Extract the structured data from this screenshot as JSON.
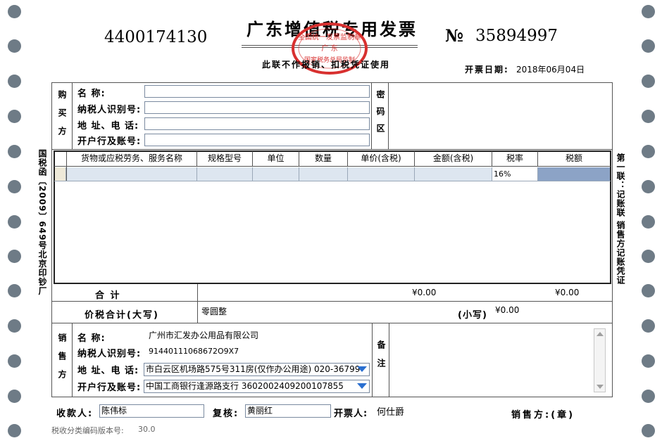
{
  "header": {
    "invoice_code": "4400174130",
    "title": "广东增值税专用发票",
    "number_symbol": "№",
    "invoice_number": "35894997",
    "subtitle": "此联不作报销、扣税凭证使用",
    "date_label": "开票日期:",
    "date_value": "2018年06月04日",
    "stamp_text": "全国统一发票监制章",
    "stamp_center": "国家税务总局监制",
    "stamp_region": "广 东"
  },
  "left_margin_text": "国税函〔2009〕649号北京印钞厂",
  "right_margin_text": "第一联：记账联 销售方记账凭证",
  "buyer": {
    "section": "购买方",
    "name_label": "名        称:",
    "taxid_label": "纳税人识别号:",
    "address_label": "地 址、电 话:",
    "bank_label": "开户行及账号:",
    "name_value": "",
    "taxid_value": "",
    "address_value": "",
    "bank_value": ""
  },
  "cipher_label": "密码区",
  "items_table": {
    "headers": [
      "货物或应税劳务、服务名称",
      "规格型号",
      "单位",
      "数量",
      "单价(含税)",
      "金额(含税)",
      "税率",
      "税额"
    ],
    "row": {
      "tax_rate": "16%"
    }
  },
  "totals": {
    "label": "合        计",
    "amount": "¥0.00",
    "tax": "¥0.00",
    "grand_label": "价税合计(大写)",
    "grand_upper": "零圆整",
    "small_label": "(小写)",
    "grand_small": "¥0.00"
  },
  "seller": {
    "section": "销售方",
    "name_label": "名        称:",
    "taxid_label": "纳税人识别号:",
    "address_label": "地 址、电 话:",
    "bank_label": "开户行及账号:",
    "name_value": "广州市汇发办公用品有限公司",
    "taxid_value": "91440111068672O9X7",
    "address_value": "市白云区机场路575号311房(仅作办公用途) 020-36799",
    "bank_value": "中国工商银行逢源路支行 3602002409200107855"
  },
  "remarks_label": "备注",
  "footer": {
    "payee_label": "收款人:",
    "payee_value": "陈伟标",
    "reviewer_label": "复核:",
    "reviewer_value": "黄丽红",
    "issuer_label": "开票人:",
    "issuer_value": "何仕爵",
    "seller_seal_label": "销售方:(章)",
    "version_label": "税收分类编码版本号:",
    "version_value": "30.0"
  },
  "colors": {
    "hole": "#6e7b86",
    "stamp": "#d8302f",
    "row_fill": "#dde6f0",
    "tax_cell": "#8ca3c6",
    "dropdown": "#2a6fd0"
  }
}
